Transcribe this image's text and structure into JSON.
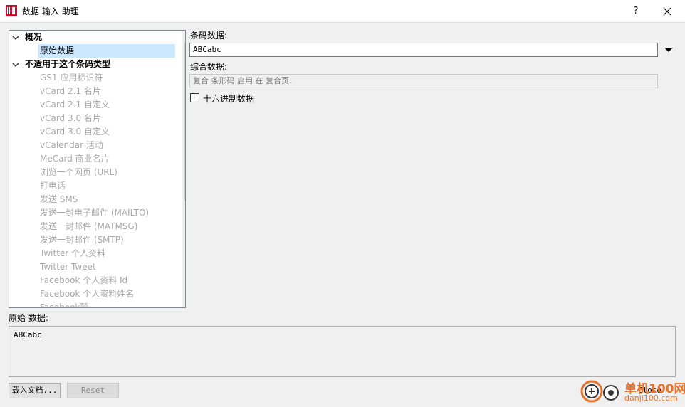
{
  "window": {
    "title": "数据 输入 助理",
    "help_label": "?"
  },
  "tree": {
    "groups": [
      {
        "label": "概况",
        "items": [
          {
            "label": "原始数据",
            "selected": true,
            "disabled": false
          }
        ]
      },
      {
        "label": "不适用于这个条码类型",
        "items": [
          {
            "label": "GS1 应用标识符",
            "disabled": true
          },
          {
            "label": "vCard 2.1 名片",
            "disabled": true
          },
          {
            "label": "vCard 2.1 自定义",
            "disabled": true
          },
          {
            "label": "vCard 3.0 名片",
            "disabled": true
          },
          {
            "label": "vCard 3.0 自定义",
            "disabled": true
          },
          {
            "label": "vCalendar 活动",
            "disabled": true
          },
          {
            "label": "MeCard 商业名片",
            "disabled": true
          },
          {
            "label": "浏览一个网页 (URL)",
            "disabled": true
          },
          {
            "label": "打电话",
            "disabled": true
          },
          {
            "label": "发送 SMS",
            "disabled": true
          },
          {
            "label": "发送一封电子邮件 (MAILTO)",
            "disabled": true
          },
          {
            "label": "发送一封邮件 (MATMSG)",
            "disabled": true
          },
          {
            "label": "发送一封邮件 (SMTP)",
            "disabled": true
          },
          {
            "label": "Twitter 个人资料",
            "disabled": true
          },
          {
            "label": "Twitter Tweet",
            "disabled": true
          },
          {
            "label": "Facebook 个人资料 Id",
            "disabled": true
          },
          {
            "label": "Facebook 个人资料姓名",
            "disabled": true
          },
          {
            "label": "Facebook赞",
            "disabled": true
          }
        ]
      }
    ]
  },
  "form": {
    "barcode_label": "条码数据:",
    "barcode_value": "ABCabc",
    "composite_label": "综合数据:",
    "composite_value": "复合 条形码 启用 在 复合页.",
    "hex_label": "十六进制数据",
    "hex_checked": false
  },
  "raw": {
    "label": "原始 数据:",
    "value": "ABCabc"
  },
  "buttons": {
    "load_doc": "载入文档...",
    "reset": "Reset",
    "close": "Close"
  },
  "watermark": {
    "line1": "单机100网",
    "line2": "danji100.com"
  },
  "colors": {
    "selection": "#cce8ff",
    "disabled_text": "#a8a8a8",
    "watermark": "#e8732c"
  }
}
